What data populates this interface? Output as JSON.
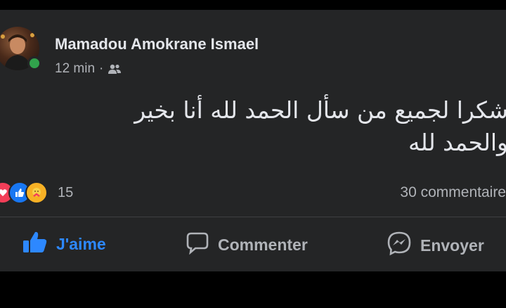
{
  "post": {
    "author": "Mamadou Amokrane Ismael",
    "time": "12 min",
    "separator": "·",
    "audience_icon": "friends-icon",
    "text_lines": [
      "شكرا لجميع من سأل الحمد لله أنا بخير",
      "والحمد لله"
    ],
    "reactions": {
      "icons": [
        "love-icon",
        "like-icon",
        "care-icon"
      ],
      "count": "15"
    },
    "comments_count": "30 commentaire"
  },
  "actions": {
    "like_label": "J'aime",
    "comment_label": "Commenter",
    "send_label": "Envoyer"
  },
  "colors": {
    "background": "#242526",
    "text": "#e4e6eb",
    "secondary": "#b0b3b8",
    "like_blue": "#2d88ff",
    "online": "#31a24c"
  }
}
